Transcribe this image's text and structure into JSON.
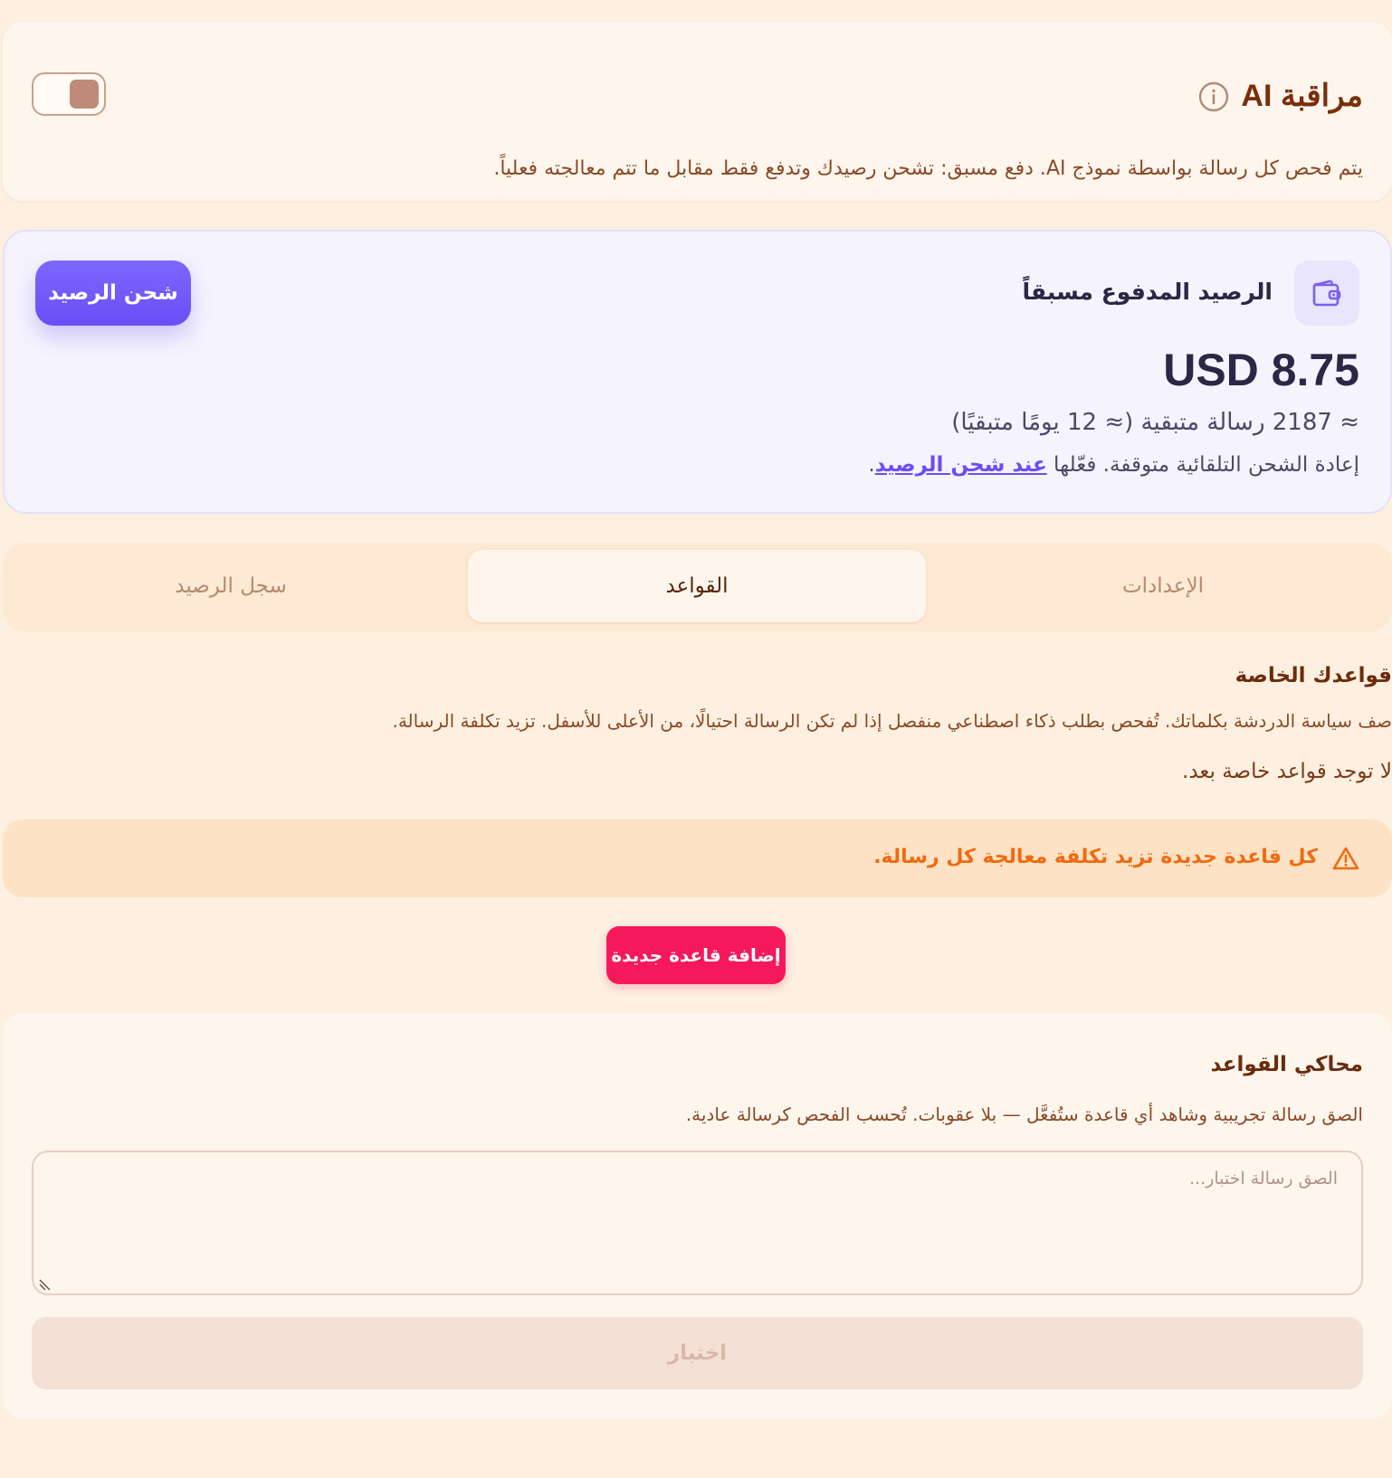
{
  "ai_moderation": {
    "title": "مراقبة AI",
    "description": "يتم فحص كل رسالة بواسطة نموذج AI. دفع مسبق: تشحن رصيدك وتدفع فقط مقابل ما تتم معالجته فعلياً.",
    "toggle_on": true,
    "info_icon": "info-icon"
  },
  "balance": {
    "title": "الرصيد المدفوع مسبقاً",
    "amount": "USD 8.75",
    "remaining": "≈ 2187 رسالة متبقية (≈ 12 يومًا متبقيًا)",
    "autotopup_text": "إعادة الشحن التلقائية متوقفة. فعّلها ",
    "autotopup_link": "عند شحن الرصيد",
    "autotopup_end": ".",
    "topup_button": "شحن الرصيد",
    "icon": "wallet-icon",
    "accent": "#6c4df5"
  },
  "tabs": {
    "settings": "الإعدادات",
    "rules": "القواعد",
    "history": "سجل الرصيد",
    "active": "rules"
  },
  "rules": {
    "title": "قواعدك الخاصة",
    "description": "صف سياسة الدردشة بكلماتك. تُفحص بطلب ذكاء اصطناعي منفصل إذا لم تكن الرسالة احتيالًا، من الأعلى للأسفل. تزيد تكلفة الرسالة.",
    "empty": "لا توجد قواعد خاصة بعد.",
    "warning": "كل قاعدة جديدة تزيد تكلفة معالجة كل رسالة.",
    "warning_icon": "warning-icon",
    "add_button": "إضافة قاعدة جديدة",
    "add_color": "#f5185a"
  },
  "simulator": {
    "title": "محاكي القواعد",
    "description": "الصق رسالة تجريبية وشاهد أي قاعدة ستُفعَّل — بلا عقوبات. تُحسب الفحص كرسالة عادية.",
    "placeholder": "الصق رسالة اختبار...",
    "value": "",
    "test_button": "اختبار"
  }
}
